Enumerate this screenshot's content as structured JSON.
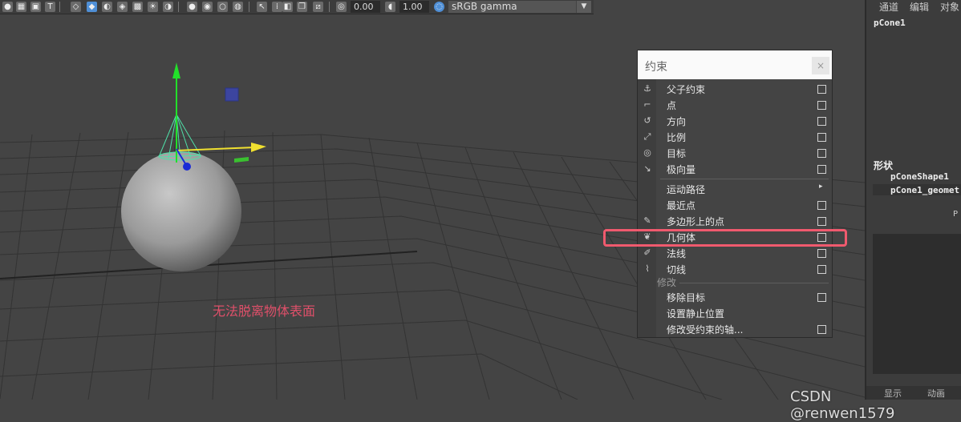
{
  "toolbar": {
    "field1": "0.00",
    "field2": "1.00",
    "colorspace": "sRGB gamma",
    "icons": [
      "grid-icon",
      "shade-icon",
      "wireframe-icon",
      "texture-icon",
      "light-icon",
      "shadow-icon",
      "isolate-icon",
      "xray-icon",
      "camera-icon",
      "resolution-icon",
      "exposure-icon",
      "gamma-icon",
      "color-management-icon"
    ]
  },
  "viewport": {
    "caption": "无法脱离物体表面",
    "watermark": "CSDN @renwen1579"
  },
  "channel_box": {
    "menu": [
      "通道",
      "编辑",
      "对象"
    ],
    "object": "pCone1",
    "shapes_title": "形状",
    "shapes": [
      "pConeShape1",
      "pCone1_geomet"
    ],
    "p_label": "P",
    "bottom_tabs": [
      "显示",
      "动画"
    ]
  },
  "constrain_panel": {
    "title": "约束",
    "close": "×",
    "items": [
      {
        "label": "父子约束",
        "icon": "parent-constraint-icon",
        "option": true
      },
      {
        "label": "点",
        "icon": "point-constraint-icon",
        "option": true
      },
      {
        "label": "方向",
        "icon": "orient-constraint-icon",
        "option": true
      },
      {
        "label": "比例",
        "icon": "scale-constraint-icon",
        "option": true
      },
      {
        "label": "目标",
        "icon": "aim-constraint-icon",
        "option": true
      },
      {
        "label": "极向量",
        "icon": "pole-vector-icon",
        "option": true
      }
    ],
    "items2": [
      {
        "label": "运动路径",
        "submenu": "▸"
      },
      {
        "label": "最近点",
        "option": true
      },
      {
        "label": "多边形上的点",
        "icon": "point-on-poly-icon",
        "option": true
      },
      {
        "label": "几何体",
        "icon": "geometry-constraint-icon",
        "option": true
      },
      {
        "label": "法线",
        "icon": "normal-constraint-icon",
        "option": true
      },
      {
        "label": "切线",
        "icon": "tangent-constraint-icon",
        "option": true
      }
    ],
    "modify_label": "修改",
    "items3": [
      {
        "label": "移除目标",
        "option": true
      },
      {
        "label": "设置静止位置",
        "option": false
      },
      {
        "label": "修改受约束的轴...",
        "option": true
      }
    ]
  },
  "colors": {
    "highlight": "#f05a6e",
    "caption": "#e0506a",
    "viewport_bg": "#444444"
  }
}
